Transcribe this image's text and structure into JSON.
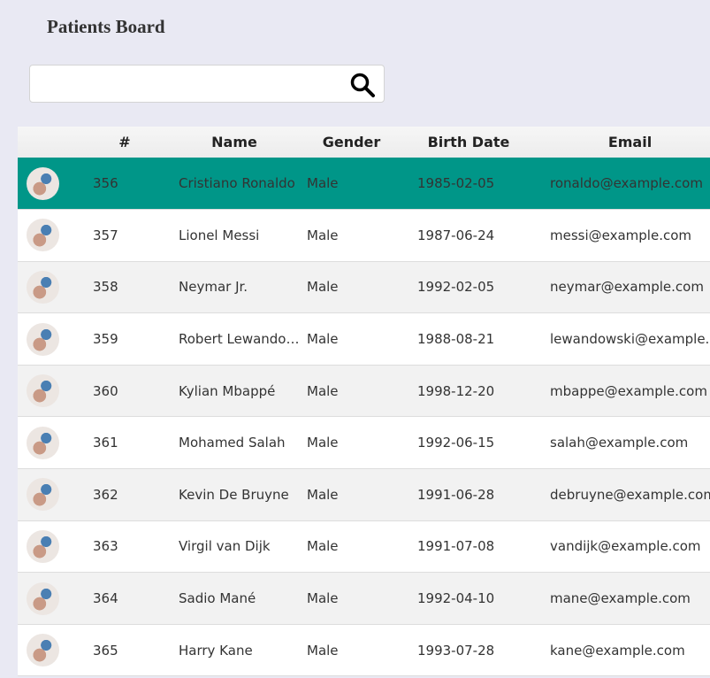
{
  "header": {
    "title": "Patients Board"
  },
  "search": {
    "value": "",
    "placeholder": "",
    "icon": "search-icon"
  },
  "colors": {
    "selected_row": "#009688",
    "background": "#e9e9f3"
  },
  "table": {
    "columns": [
      "",
      "#",
      "Name",
      "Gender",
      "Birth Date",
      "Email"
    ],
    "rows": [
      {
        "id": "356",
        "name": "Cristiano Ronaldo",
        "gender": "Male",
        "birth": "1985-02-05",
        "email": "ronaldo@example.com",
        "selected": true
      },
      {
        "id": "357",
        "name": "Lionel Messi",
        "gender": "Male",
        "birth": "1987-06-24",
        "email": "messi@example.com"
      },
      {
        "id": "358",
        "name": "Neymar Jr.",
        "gender": "Male",
        "birth": "1992-02-05",
        "email": "neymar@example.com"
      },
      {
        "id": "359",
        "name": "Robert Lewandowski",
        "gender": "Male",
        "birth": "1988-08-21",
        "email": "lewandowski@example.com"
      },
      {
        "id": "360",
        "name": "Kylian Mbappé",
        "gender": "Male",
        "birth": "1998-12-20",
        "email": "mbappe@example.com"
      },
      {
        "id": "361",
        "name": "Mohamed Salah",
        "gender": "Male",
        "birth": "1992-06-15",
        "email": "salah@example.com"
      },
      {
        "id": "362",
        "name": "Kevin De Bruyne",
        "gender": "Male",
        "birth": "1991-06-28",
        "email": "debruyne@example.com"
      },
      {
        "id": "363",
        "name": "Virgil van Dijk",
        "gender": "Male",
        "birth": "1991-07-08",
        "email": "vandijk@example.com"
      },
      {
        "id": "364",
        "name": "Sadio Mané",
        "gender": "Male",
        "birth": "1992-04-10",
        "email": "mane@example.com"
      },
      {
        "id": "365",
        "name": "Harry Kane",
        "gender": "Male",
        "birth": "1993-07-28",
        "email": "kane@example.com"
      }
    ]
  }
}
